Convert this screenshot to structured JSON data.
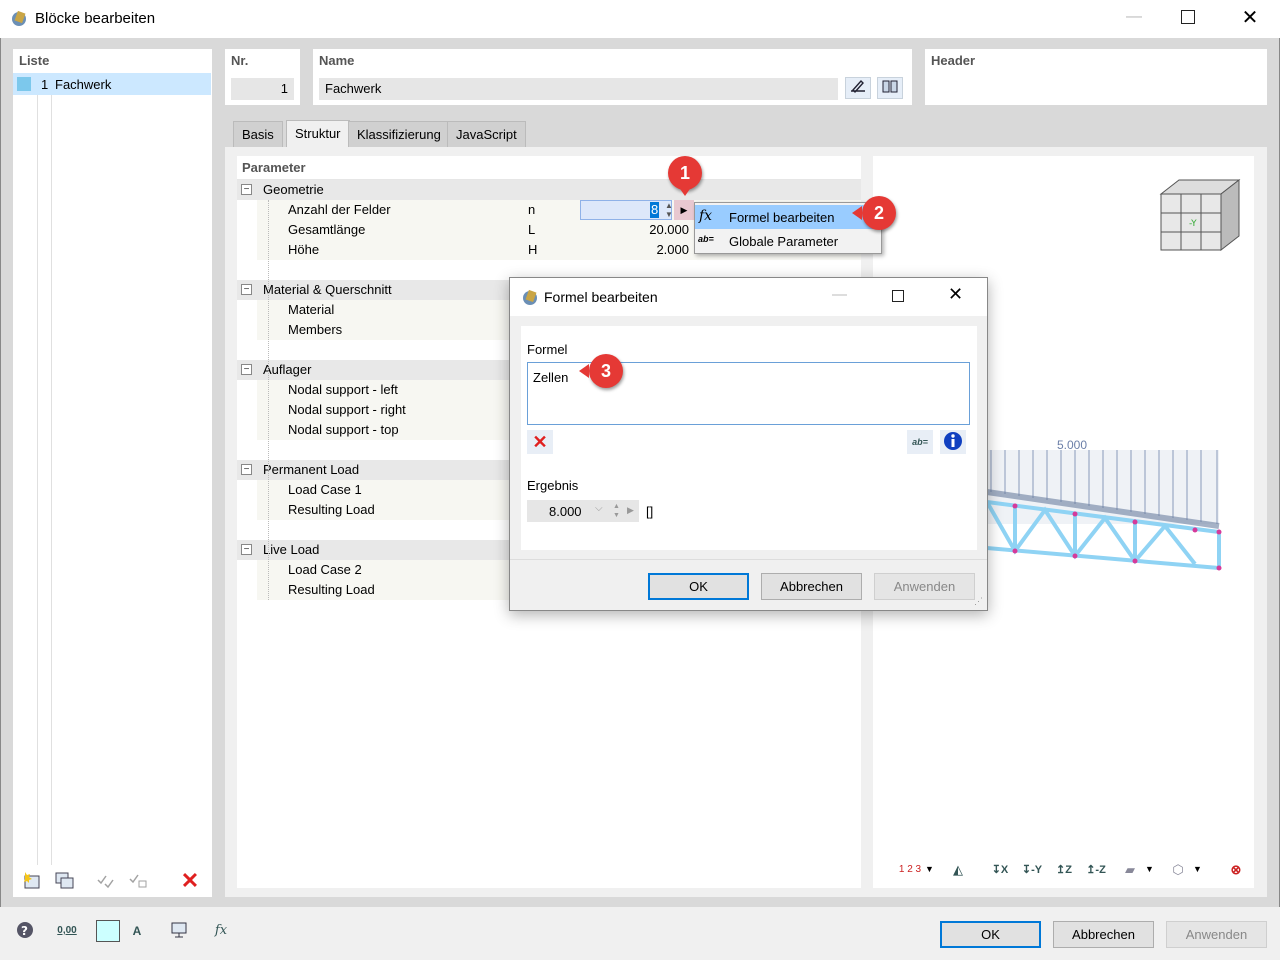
{
  "window": {
    "title": "Blöcke bearbeiten"
  },
  "list": {
    "header": "Liste",
    "items": [
      {
        "number": "1",
        "label": "Fachwerk"
      }
    ]
  },
  "nr": {
    "label": "Nr.",
    "value": "1"
  },
  "name": {
    "label": "Name",
    "value": "Fachwerk"
  },
  "header_field": {
    "label": "Header"
  },
  "tabs": [
    {
      "label": "Basis"
    },
    {
      "label": "Struktur"
    },
    {
      "label": "Klassifizierung"
    },
    {
      "label": "JavaScript"
    }
  ],
  "params": {
    "header": "Parameter",
    "groups": [
      {
        "label": "Geometrie",
        "rows": [
          {
            "label": "Anzahl der Felder",
            "symbol": "n",
            "value": "8"
          },
          {
            "label": "Gesamtlänge",
            "symbol": "L",
            "value": "20.000"
          },
          {
            "label": "Höhe",
            "symbol": "H",
            "value": "2.000"
          }
        ]
      },
      {
        "label": "Material & Querschnitt",
        "rows": [
          {
            "label": "Material"
          },
          {
            "label": "Members"
          }
        ]
      },
      {
        "label": "Auflager",
        "rows": [
          {
            "label": "Nodal support - left"
          },
          {
            "label": "Nodal support - right"
          },
          {
            "label": "Nodal support - top"
          }
        ]
      },
      {
        "label": "Permanent Load",
        "rows": [
          {
            "label": "Load Case 1"
          },
          {
            "label": "Resulting Load"
          }
        ]
      },
      {
        "label": "Live Load",
        "rows": [
          {
            "label": "Load Case 2"
          },
          {
            "label": "Resulting Load"
          }
        ]
      }
    ]
  },
  "context_menu": {
    "items": [
      {
        "icon": "fx",
        "label": "Formel bearbeiten"
      },
      {
        "icon": "ab=",
        "label": "Globale Parameter"
      }
    ]
  },
  "badges": [
    "1",
    "2",
    "3"
  ],
  "dialog": {
    "title": "Formel bearbeiten",
    "formula_label": "Formel",
    "formula_value": "Zellen",
    "result_label": "Ergebnis",
    "result_value": "8.000",
    "result_unit": "[]",
    "ok": "OK",
    "cancel": "Abbrechen",
    "apply": "Anwenden"
  },
  "preview": {
    "load_label": "5.000"
  },
  "footer": {
    "ok": "OK",
    "cancel": "Abbrechen",
    "apply": "Anwenden",
    "zero_label": "0,00"
  },
  "colors": {
    "accent": "#0078d7",
    "badge": "#e53935",
    "selection": "#cce8ff",
    "member": "#8fd3f4",
    "node": "#d63a9a"
  }
}
